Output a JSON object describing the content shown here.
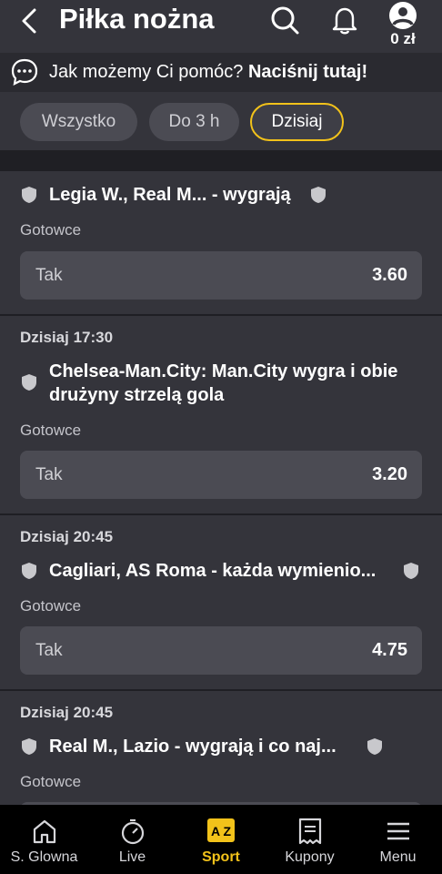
{
  "header": {
    "title": "Piłka nożna",
    "balance": "0 zł"
  },
  "help": {
    "question": "Jak możemy Ci pomóc?",
    "cta": "Naciśnij tutaj!"
  },
  "filters": [
    {
      "label": "Wszystko",
      "active": false
    },
    {
      "label": "Do 3 h",
      "active": false
    },
    {
      "label": "Dzisiaj",
      "active": true
    }
  ],
  "events": [
    {
      "date": "",
      "title": "Legia W., Real M... - wygrają",
      "subtitle": "Gotowce",
      "odd_label": "Tak",
      "odd_value": "3.60"
    },
    {
      "date": "Dzisiaj 17:30",
      "title": "Chelsea-Man.City: Man.City wygra i obie drużyny strzelą gola",
      "subtitle": "Gotowce",
      "odd_label": "Tak",
      "odd_value": "3.20"
    },
    {
      "date": "Dzisiaj 20:45",
      "title": "Cagliari, AS Roma - każda wymienio...",
      "subtitle": "Gotowce",
      "odd_label": "Tak",
      "odd_value": "4.75"
    },
    {
      "date": "Dzisiaj 20:45",
      "title": "Real M., Lazio - wygrają i co naj...",
      "subtitle": "Gotowce",
      "odd_label": "",
      "odd_value": ""
    }
  ],
  "nav": [
    {
      "label": "S. Glowna",
      "icon": "home-icon",
      "active": false
    },
    {
      "label": "Live",
      "icon": "stopwatch-icon",
      "active": false
    },
    {
      "label": "Sport",
      "icon": "az-icon",
      "active": true,
      "badge": "A Z"
    },
    {
      "label": "Kupony",
      "icon": "receipt-icon",
      "active": false
    },
    {
      "label": "Menu",
      "icon": "hamburger-icon",
      "active": false
    }
  ],
  "colors": {
    "accent": "#f2c21a",
    "card": "#34343b",
    "background": "#1f1f24",
    "button": "#4b4b53"
  }
}
